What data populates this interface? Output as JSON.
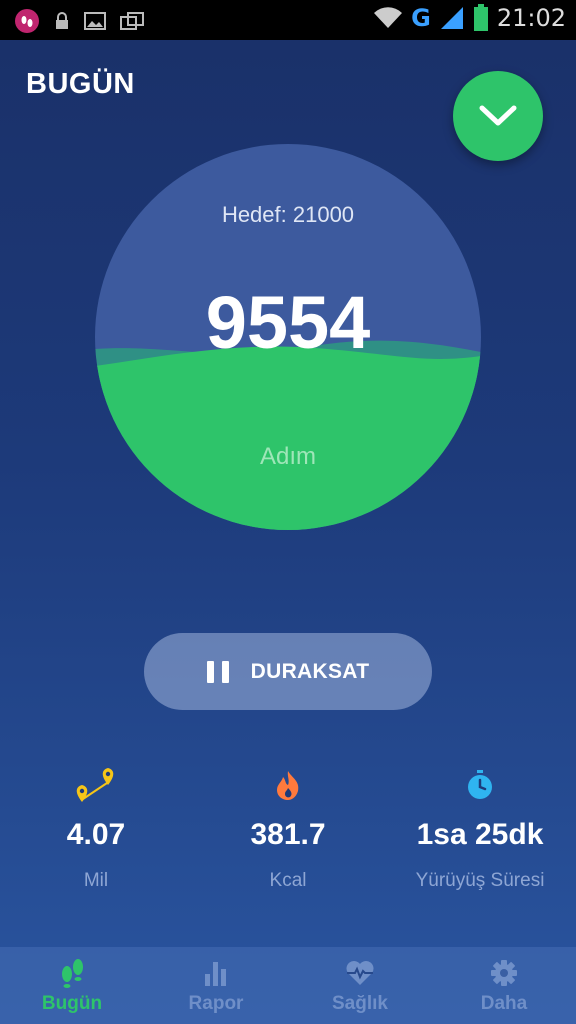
{
  "status_bar": {
    "time": "21:02",
    "network": "G"
  },
  "header": {
    "title": "BUGÜN"
  },
  "gauge": {
    "goal_text": "Hedef: 21000",
    "steps": "9554",
    "unit": "Adım",
    "progress_fraction": 0.455,
    "colors": {
      "fill": "#2ec46a",
      "empty": "#3f5aa0"
    }
  },
  "pause_button": {
    "label": "DURAKSAT",
    "icon": "pause-icon"
  },
  "stats": [
    {
      "icon": "distance-pin-icon",
      "value": "4.07",
      "label": "Mil"
    },
    {
      "icon": "flame-icon",
      "value": "381.7",
      "label": "Kcal"
    },
    {
      "icon": "stopwatch-icon",
      "value": "1sa 25dk",
      "label": "Yürüyüş Süresi"
    }
  ],
  "bottom_nav": [
    {
      "icon": "footsteps-icon",
      "label": "Bugün",
      "active": true
    },
    {
      "icon": "bar-chart-icon",
      "label": "Rapor",
      "active": false
    },
    {
      "icon": "heart-pulse-icon",
      "label": "Sağlık",
      "active": false
    },
    {
      "icon": "gear-icon",
      "label": "Daha",
      "active": false
    }
  ],
  "colors": {
    "accent": "#2ec46a",
    "background": "#1d3a7a"
  }
}
